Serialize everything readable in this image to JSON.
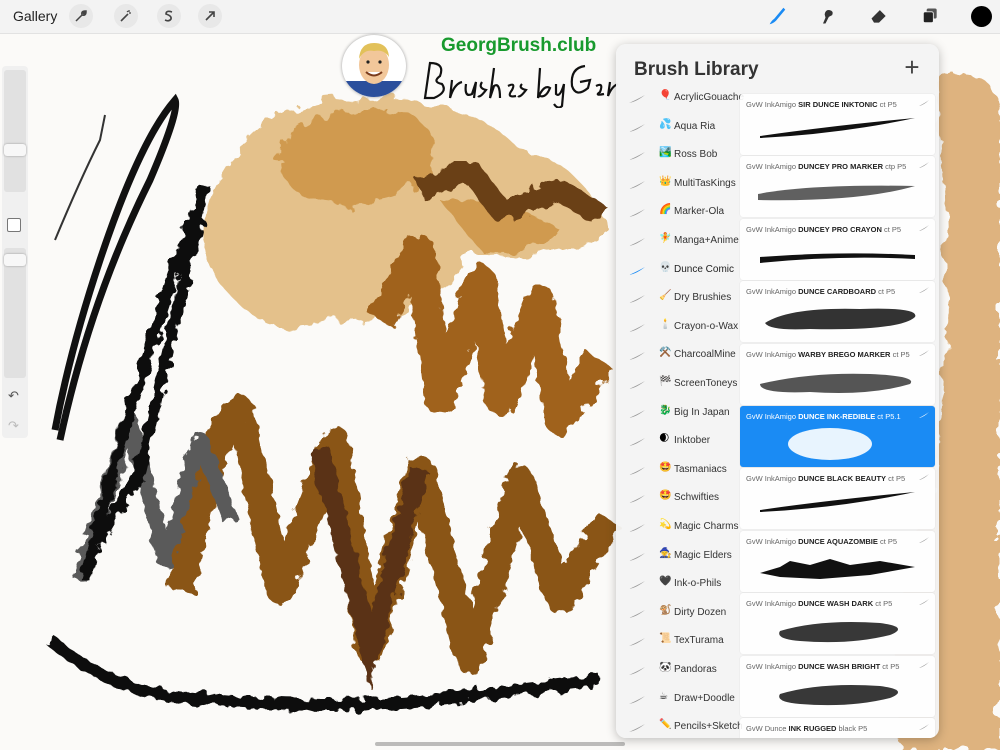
{
  "topbar": {
    "gallery_label": "Gallery",
    "left_tools": [
      "wrench-icon",
      "magic-wand-icon",
      "selection-s-icon",
      "transform-arrow-icon"
    ],
    "right_tools": [
      "brush-icon",
      "smudge-icon",
      "eraser-icon",
      "layers-icon"
    ],
    "active_tool": "brush-icon",
    "current_color": "#000000",
    "accent_color": "#1a8bf4"
  },
  "logo": {
    "title_main": "GeorgBrush",
    "title_suffix": ".club",
    "script_text": "Brushes by Georg"
  },
  "library": {
    "title": "Brush Library",
    "add_label": "+",
    "sets": [
      {
        "emoji": "🎈",
        "name": "AcrylicGouache"
      },
      {
        "emoji": "💦",
        "name": "Aqua Ria"
      },
      {
        "emoji": "🏞️",
        "name": "Ross Bob"
      },
      {
        "emoji": "👑",
        "name": "MultiTasKings"
      },
      {
        "emoji": "🌈",
        "name": "Marker-Ola"
      },
      {
        "emoji": "🧚",
        "name": "Manga+Anime"
      },
      {
        "emoji": "💀",
        "name": "Dunce Comic"
      },
      {
        "emoji": "🧹",
        "name": "Dry Brushies"
      },
      {
        "emoji": "🕯️",
        "name": "Crayon-o-Wax"
      },
      {
        "emoji": "⚒️",
        "name": "CharcoalMine"
      },
      {
        "emoji": "🏁",
        "name": "ScreenToneys"
      },
      {
        "emoji": "🐉",
        "name": "Big In Japan"
      },
      {
        "emoji": "🌒",
        "name": "Inktober"
      },
      {
        "emoji": "🤩",
        "name": "Tasmaniacs"
      },
      {
        "emoji": "🤩",
        "name": "Schwifties"
      },
      {
        "emoji": "💫",
        "name": "Magic Charms"
      },
      {
        "emoji": "🧙",
        "name": "Magic Elders"
      },
      {
        "emoji": "🖤",
        "name": "Ink-o-Phils"
      },
      {
        "emoji": "🐒",
        "name": "Dirty Dozen"
      },
      {
        "emoji": "📜",
        "name": "TexTurama"
      },
      {
        "emoji": "🐼",
        "name": "Pandoras"
      },
      {
        "emoji": "☕",
        "name": "Draw+Doodle"
      },
      {
        "emoji": "✏️",
        "name": "Pencils+Sketch"
      }
    ],
    "active_set": "Dunce Comic",
    "brushes": [
      {
        "prefix": "GvW InkAmigo",
        "name": "SIR DUNCE INKTONIC",
        "suffix": "ct P5",
        "preview": "taper"
      },
      {
        "prefix": "GvW InkAmigo",
        "name": "DUNCEY PRO MARKER",
        "suffix": "ctp P5",
        "preview": "grainy"
      },
      {
        "prefix": "GvW InkAmigo",
        "name": "DUNCEY PRO CRAYON",
        "suffix": "ct P5",
        "preview": "line"
      },
      {
        "prefix": "GvW InkAmigo",
        "name": "DUNCE CARDBOARD",
        "suffix": "ct P5",
        "preview": "blob"
      },
      {
        "prefix": "GvW InkAmigo",
        "name": "WARBY BREGO MARKER",
        "suffix": "ct P5",
        "preview": "textured"
      },
      {
        "prefix": "GvW InkAmigo",
        "name": "DUNCE INK-REDIBLE",
        "suffix": "ct P5.1",
        "preview": "splat"
      },
      {
        "prefix": "GvW InkAmigo",
        "name": "DUNCE BLACK BEAUTY",
        "suffix": "ct P5",
        "preview": "taper"
      },
      {
        "prefix": "GvW InkAmigo",
        "name": "DUNCE AQUAZOMBIE",
        "suffix": "ct P5",
        "preview": "spiky"
      },
      {
        "prefix": "GvW InkAmigo",
        "name": "DUNCE WASH DARK",
        "suffix": "ct P5",
        "preview": "wash"
      },
      {
        "prefix": "GvW InkAmigo",
        "name": "DUNCE WASH BRIGHT",
        "suffix": "ct P5",
        "preview": "wash"
      },
      {
        "prefix": "GvW Dunce",
        "name": "INK RUGGED",
        "suffix": "black P5",
        "preview": "none"
      }
    ],
    "selected_brush": "DUNCE INK-REDIBLE"
  }
}
